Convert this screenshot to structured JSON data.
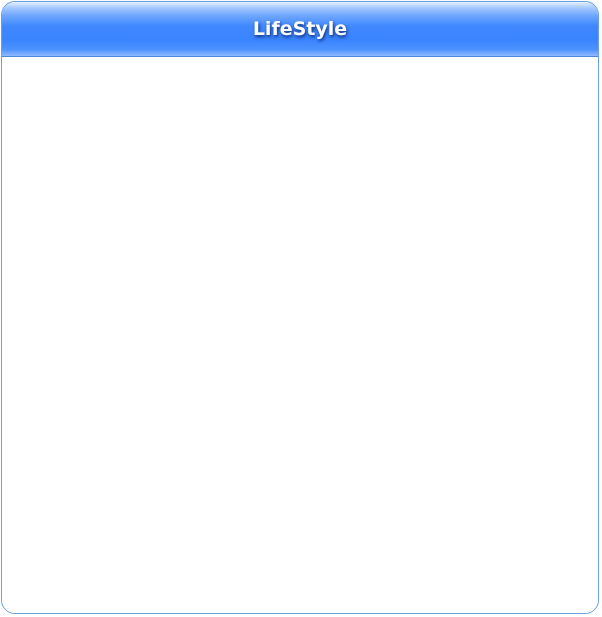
{
  "panel": {
    "title": "LifeStyle"
  },
  "colors": {
    "header_blue": "#3a84ff",
    "border_blue": "#6a9fe6",
    "title_text": "#ffffff",
    "body_background": "#ffffff"
  }
}
